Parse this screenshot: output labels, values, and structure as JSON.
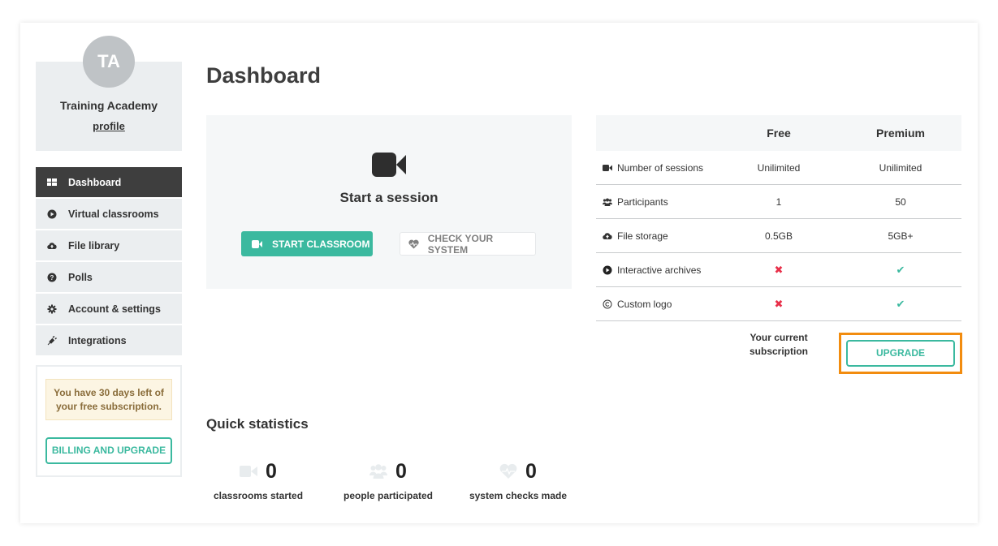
{
  "profile": {
    "initials": "TA",
    "name": "Training Academy",
    "link": "profile"
  },
  "sidebar": {
    "items": [
      {
        "label": "Dashboard",
        "icon": "grid-icon",
        "active": true
      },
      {
        "label": "Virtual classrooms",
        "icon": "play-circle-icon",
        "active": false
      },
      {
        "label": "File library",
        "icon": "cloud-upload-icon",
        "active": false
      },
      {
        "label": "Polls",
        "icon": "question-circle-icon",
        "active": false
      },
      {
        "label": "Account & settings",
        "icon": "gear-icon",
        "active": false
      },
      {
        "label": "Integrations",
        "icon": "plug-icon",
        "active": false
      }
    ],
    "subscription_notice": "You have 30 days left of your free subscription.",
    "billing_button": "BILLING AND UPGRADE"
  },
  "main": {
    "title": "Dashboard",
    "session": {
      "icon": "video-camera-icon",
      "title": "Start a session",
      "start_button": "START CLASSROOM",
      "check_button": "CHECK YOUR SYSTEM"
    },
    "plans": {
      "headers": [
        "",
        "Free",
        "Premium"
      ],
      "rows": [
        {
          "icon": "video-camera-icon",
          "feature": "Number of sessions",
          "free": "Unilimited",
          "premium": "Unilimited"
        },
        {
          "icon": "users-icon",
          "feature": "Participants",
          "free": "1",
          "premium": "50"
        },
        {
          "icon": "cloud-upload-icon",
          "feature": "File storage",
          "free": "0.5GB",
          "premium": "5GB+"
        },
        {
          "icon": "play-circle-icon",
          "feature": "Interactive archives",
          "free": "✖",
          "premium": "✔"
        },
        {
          "icon": "copyright-icon",
          "feature": "Custom logo",
          "free": "✖",
          "premium": "✔"
        }
      ],
      "current_subscription": "Your current subscription",
      "upgrade_button": "UPGRADE"
    },
    "stats": {
      "title": "Quick statistics",
      "items": [
        {
          "icon": "video-camera-icon",
          "value": "0",
          "label": "classrooms started"
        },
        {
          "icon": "users-icon",
          "value": "0",
          "label": "people participated"
        },
        {
          "icon": "heartbeat-icon",
          "value": "0",
          "label": "system checks made"
        }
      ]
    }
  },
  "colors": {
    "accent": "#3bb99f",
    "active_nav": "#3e3e3e",
    "highlight": "#f28c0f",
    "cross": "#e8304a"
  }
}
